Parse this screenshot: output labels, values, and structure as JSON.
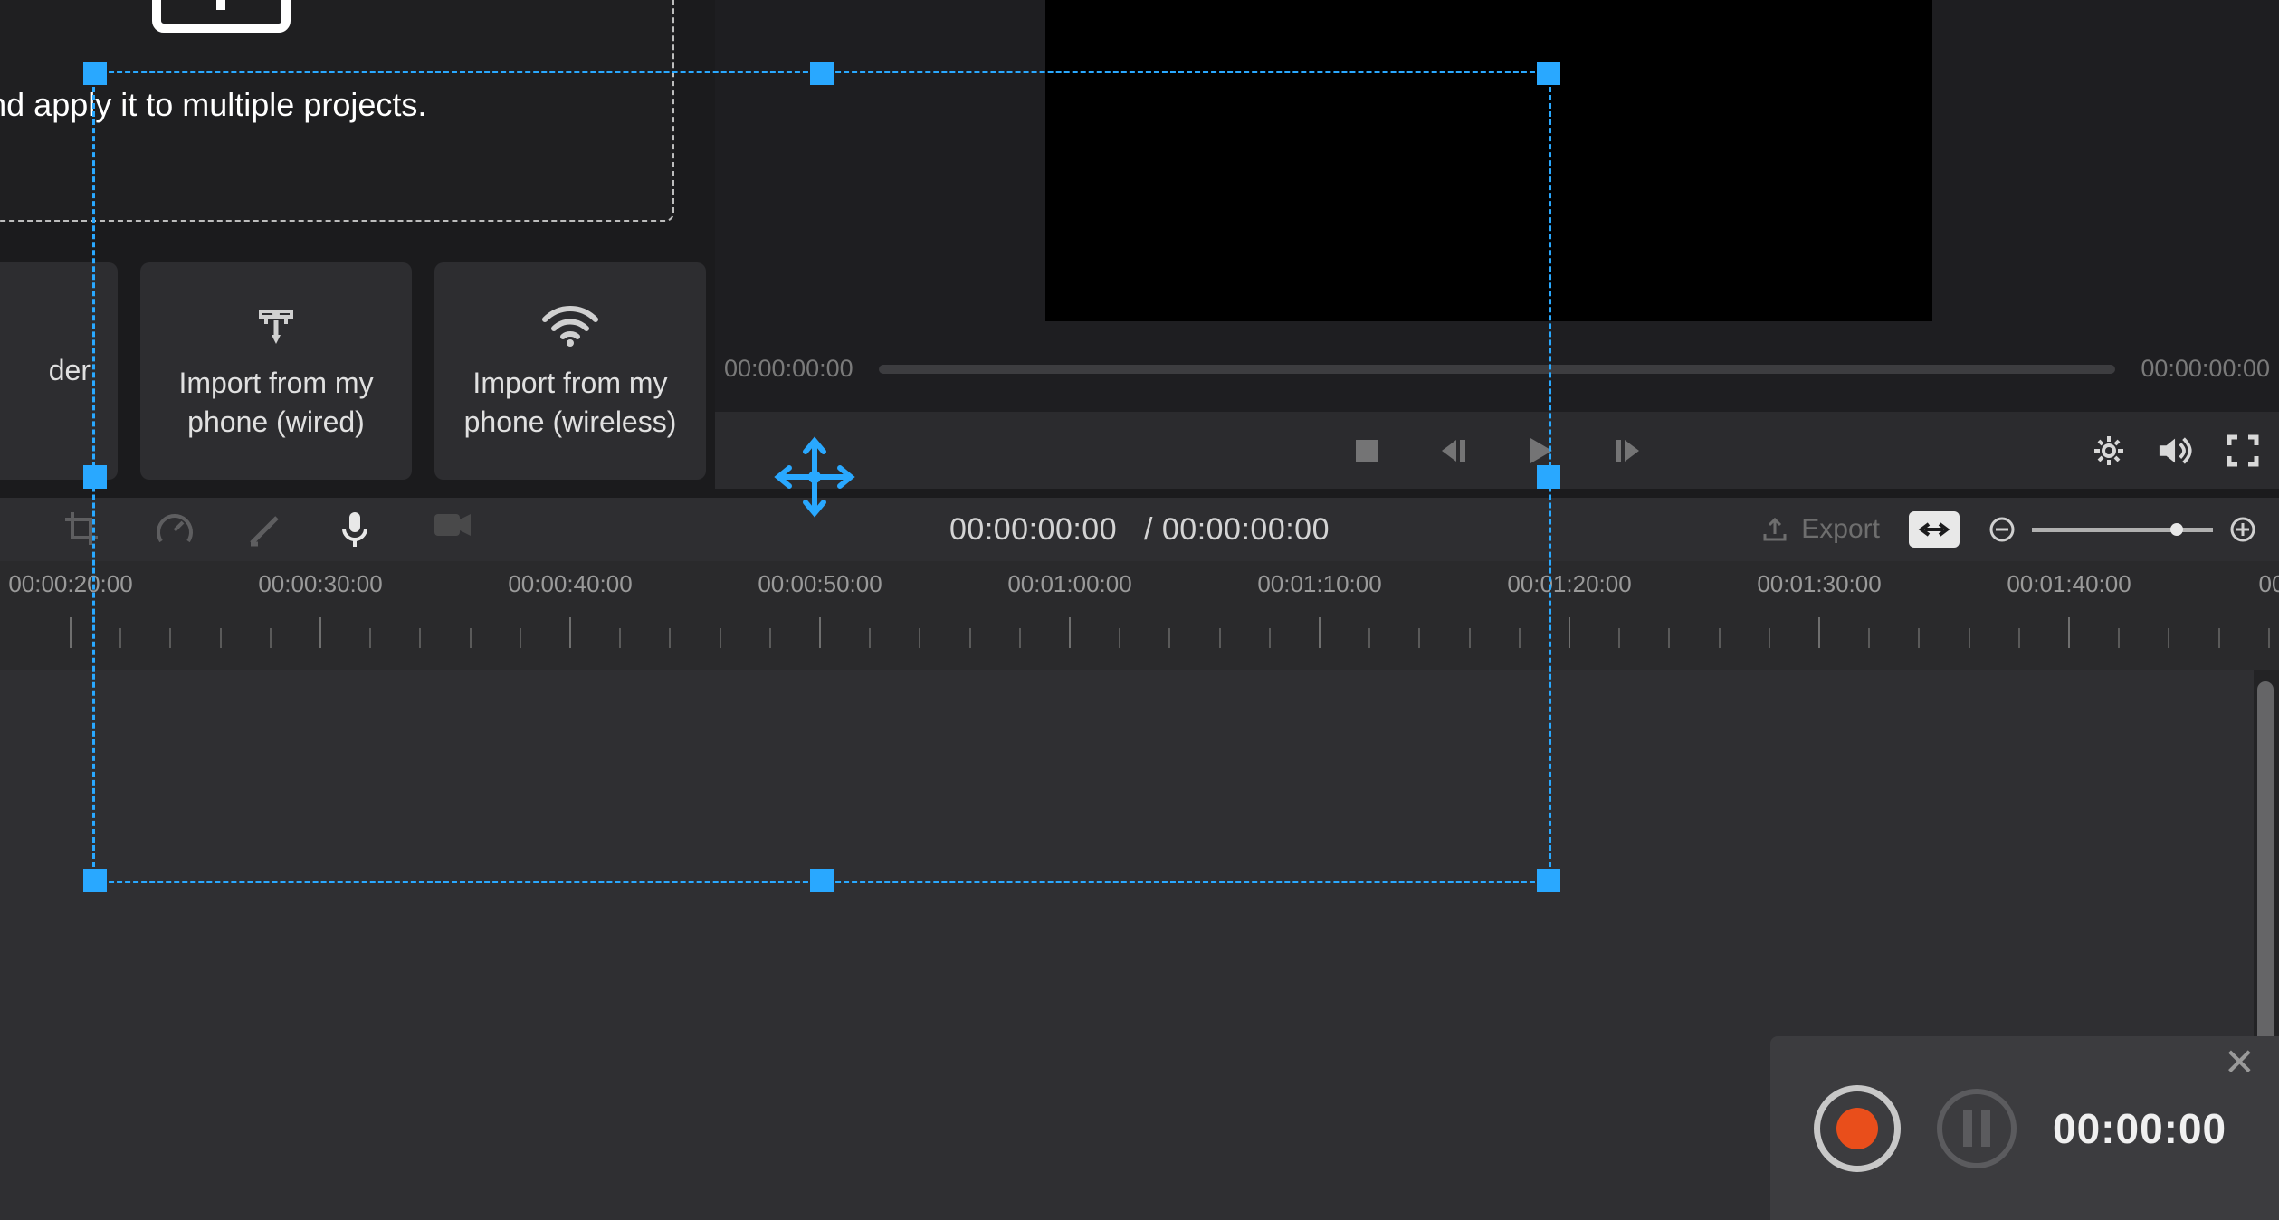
{
  "dropzone": {
    "hint": "edia here and apply it to multiple projects."
  },
  "import": {
    "folder_label": "der",
    "wired_label": "Import from my\nphone (wired)",
    "wireless_label": "Import from my\nphone (wireless)"
  },
  "preview": {
    "progress_left": "00:00:00:00",
    "progress_right": "00:00:00:00"
  },
  "toolbar": {
    "counter_current": "00:00:00:00",
    "counter_sep": "/",
    "counter_total": "00:00:00:00",
    "export_label": "Export"
  },
  "timeline": {
    "ticks": [
      "00:00:20:00",
      "00:00:30:00",
      "00:00:40:00",
      "00:00:50:00",
      "00:01:00:00",
      "00:01:10:00",
      "00:01:20:00",
      "00:01:30:00",
      "00:01:40:00"
    ],
    "right_cut": "00"
  },
  "record": {
    "time": "00:00:00"
  },
  "colors": {
    "accent": "#29a8ff",
    "record": "#e94e1b"
  }
}
